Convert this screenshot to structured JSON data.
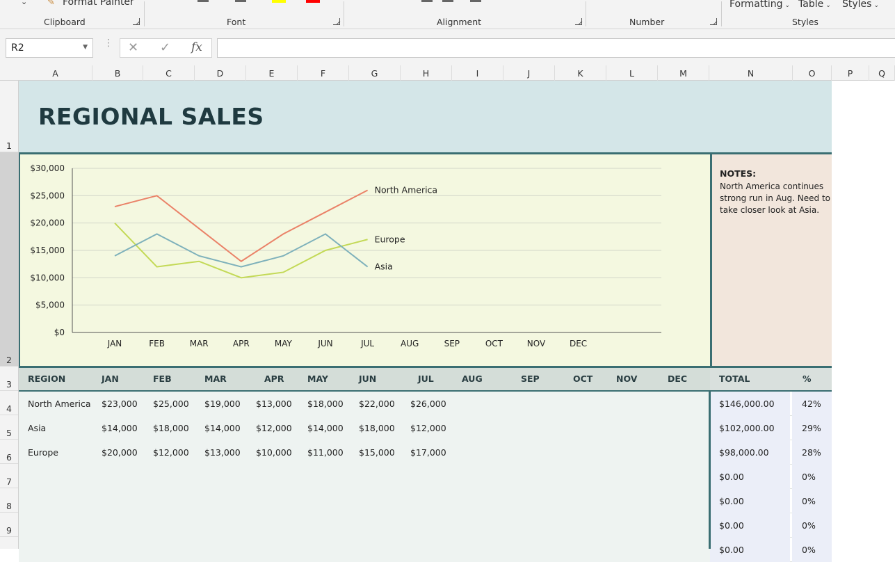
{
  "ribbon": {
    "format_painter": "Format Painter",
    "groups": [
      "Clipboard",
      "Font",
      "Alignment",
      "Number",
      "Styles"
    ],
    "styles_buttons": [
      "Formatting",
      "Table",
      "Styles"
    ]
  },
  "formula_bar": {
    "name_box": "R2",
    "cancel_glyph": "✕",
    "enter_glyph": "✓",
    "fx": "fx",
    "formula": ""
  },
  "columns": [
    "A",
    "B",
    "C",
    "D",
    "E",
    "F",
    "G",
    "H",
    "I",
    "J",
    "K",
    "L",
    "M",
    "N",
    "O",
    "P",
    "Q"
  ],
  "rows": [
    "1",
    "2",
    "3",
    "4",
    "5",
    "6",
    "7",
    "8",
    "9"
  ],
  "selected_row": "2",
  "title": "REGIONAL SALES",
  "notes": {
    "heading": "NOTES:",
    "body": "North America continues strong run in Aug. Need to take closer look at Asia."
  },
  "colors": {
    "north_america": "#ea8268",
    "asia": "#7eb1bb",
    "europe": "#c3d956",
    "header_border": "#3a6e72"
  },
  "chart_data": {
    "type": "line",
    "categories": [
      "JAN",
      "FEB",
      "MAR",
      "APR",
      "MAY",
      "JUN",
      "JUL",
      "AUG",
      "SEP",
      "OCT",
      "NOV",
      "DEC"
    ],
    "yticks": [
      "$30,000",
      "$25,000",
      "$20,000",
      "$15,000",
      "$10,000",
      "$5,000",
      "$0"
    ],
    "ylim": [
      0,
      30000
    ],
    "grid": true,
    "series": [
      {
        "name": "North America",
        "values": [
          23000,
          25000,
          19000,
          13000,
          18000,
          22000,
          26000
        ]
      },
      {
        "name": "Europe",
        "values": [
          20000,
          12000,
          13000,
          10000,
          11000,
          15000,
          17000
        ]
      },
      {
        "name": "Asia",
        "values": [
          14000,
          18000,
          14000,
          12000,
          14000,
          18000,
          12000
        ]
      }
    ]
  },
  "table": {
    "headers": [
      "REGION",
      "JAN",
      "FEB",
      "MAR",
      "APR",
      "MAY",
      "JUN",
      "JUL",
      "AUG",
      "SEP",
      "OCT",
      "NOV",
      "DEC",
      "TOTAL",
      "%"
    ],
    "rows": [
      {
        "region": "North America",
        "months": [
          "$23,000",
          "$25,000",
          "$19,000",
          "$13,000",
          "$18,000",
          "$22,000",
          "$26,000"
        ],
        "total": "$146,000.00",
        "pct": "42%"
      },
      {
        "region": "Asia",
        "months": [
          "$14,000",
          "$18,000",
          "$14,000",
          "$12,000",
          "$14,000",
          "$18,000",
          "$12,000"
        ],
        "total": "$102,000.00",
        "pct": "29%"
      },
      {
        "region": "Europe",
        "months": [
          "$20,000",
          "$12,000",
          "$13,000",
          "$10,000",
          "$11,000",
          "$15,000",
          "$17,000"
        ],
        "total": "$98,000.00",
        "pct": "28%"
      },
      {
        "region": "",
        "months": [],
        "total": "$0.00",
        "pct": "0%"
      },
      {
        "region": "",
        "months": [],
        "total": "$0.00",
        "pct": "0%"
      },
      {
        "region": "",
        "months": [],
        "total": "$0.00",
        "pct": "0%"
      },
      {
        "region": "",
        "months": [],
        "total": "$0.00",
        "pct": "0%"
      }
    ]
  }
}
